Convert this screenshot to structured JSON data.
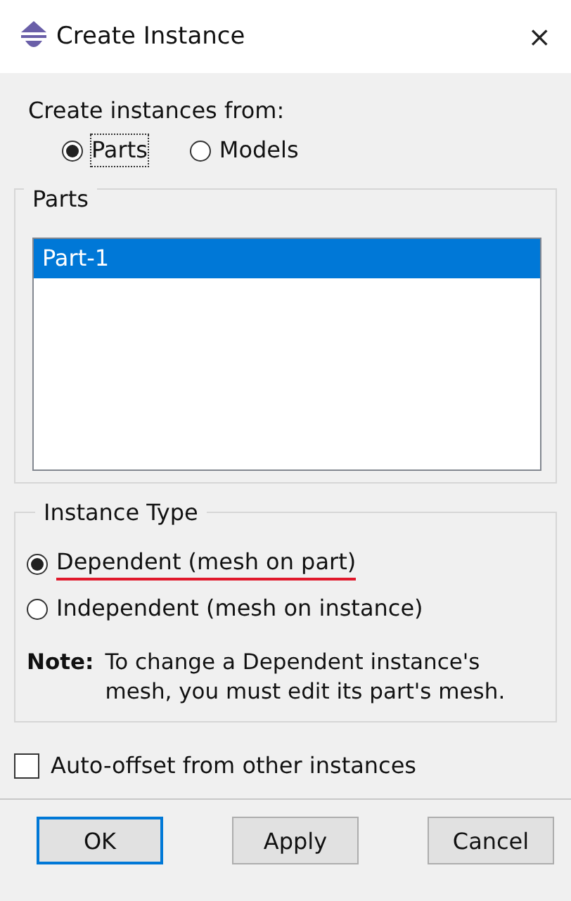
{
  "window": {
    "title": "Create Instance",
    "close": "×"
  },
  "source": {
    "label": "Create instances from:",
    "options": [
      {
        "label": "Parts",
        "selected": true
      },
      {
        "label": "Models",
        "selected": false
      }
    ]
  },
  "parts": {
    "title": "Parts",
    "items": [
      {
        "label": "Part-1",
        "selected": true
      }
    ]
  },
  "instance_type": {
    "title": "Instance Type",
    "options": [
      {
        "label": "Dependent (mesh on part)",
        "selected": true,
        "underlined": true
      },
      {
        "label": "Independent (mesh on instance)",
        "selected": false,
        "underlined": false
      }
    ],
    "note_label": "Note:",
    "note": "To change a Dependent instance's mesh, you must edit its part's mesh."
  },
  "auto_offset": {
    "label": "Auto-offset from other instances",
    "checked": false
  },
  "buttons": [
    {
      "label": "OK",
      "default": true
    },
    {
      "label": "Apply",
      "default": false
    },
    {
      "label": "Cancel",
      "default": false
    }
  ]
}
